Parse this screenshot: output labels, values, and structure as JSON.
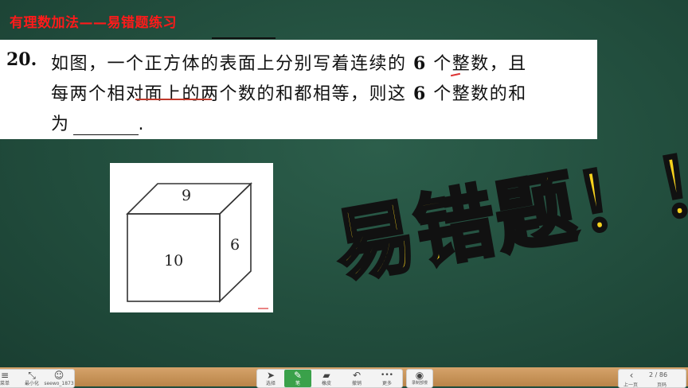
{
  "lesson_title": "有理数加法——易错题练习",
  "question": {
    "number": "20.",
    "line1_pre": "如图，一个正方体的表面上分别写着连续的 ",
    "line1_num": "6",
    "line1_post": " 个整数，且",
    "line2_pre": "每两个相对面上的两个数的和都相等，则这 ",
    "line2_num": "6",
    "line2_post": " 个整数的和",
    "line3_pre": "为",
    "line3_post": "."
  },
  "figure": {
    "top_face": "9",
    "front_face": "10",
    "side_face": "6"
  },
  "warning": "易错题！！",
  "toolbar": {
    "left_tools": [
      {
        "icon": "≡",
        "label": "菜单"
      },
      {
        "icon": "⤡",
        "label": "最小化"
      },
      {
        "icon": "☺",
        "label": "seewo_1873"
      }
    ],
    "center_tools": [
      {
        "icon": "➤",
        "label": "选择"
      },
      {
        "icon": "✎",
        "label": "笔"
      },
      {
        "icon": "▰",
        "label": "橡皮"
      },
      {
        "icon": "↶",
        "label": "撤销"
      },
      {
        "icon": "•••",
        "label": "更多"
      }
    ],
    "record": {
      "icon": "◉",
      "label": "录制部慢"
    },
    "pager": {
      "prev_icon": "‹",
      "prev_label": "上一页",
      "page_count": "2 / 86",
      "page_label": "页码"
    }
  },
  "colors": {
    "board": "#214c3c",
    "title": "#ff1a1a",
    "warning": "#f7d21d",
    "active_tool": "#3aa14a"
  }
}
